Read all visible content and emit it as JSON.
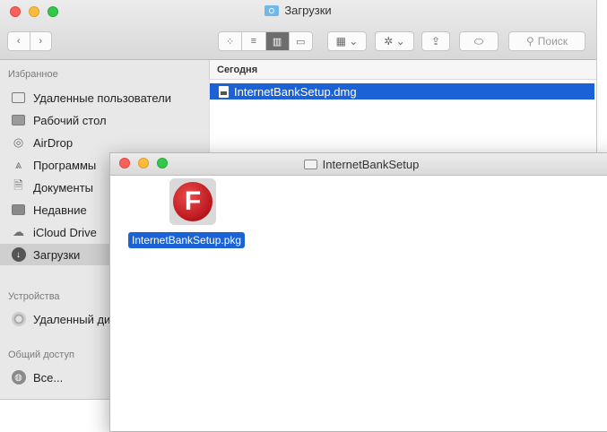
{
  "finder": {
    "title": "Загрузки",
    "search_placeholder": "Поиск",
    "sidebar": {
      "favorites_header": "Избранное",
      "favorites": [
        {
          "label": "Удаленные пользователи",
          "icon": "folder-icon"
        },
        {
          "label": "Рабочий стол",
          "icon": "desktop-icon"
        },
        {
          "label": "AirDrop",
          "icon": "airdrop-icon"
        },
        {
          "label": "Программы",
          "icon": "applications-icon"
        },
        {
          "label": "Документы",
          "icon": "documents-icon"
        },
        {
          "label": "Недавние",
          "icon": "recents-icon"
        },
        {
          "label": "iCloud Drive",
          "icon": "cloud-icon"
        },
        {
          "label": "Загрузки",
          "icon": "downloads-icon",
          "selected": true
        }
      ],
      "devices_header": "Устройства",
      "devices": [
        {
          "label": "Удаленный диск",
          "icon": "disc-icon"
        }
      ],
      "shared_header": "Общий доступ",
      "shared": [
        {
          "label": "Все...",
          "icon": "globe-icon"
        }
      ]
    },
    "column_header": "Сегодня",
    "files": [
      {
        "name": "InternetBankSetup.dmg",
        "selected": true
      }
    ]
  },
  "disk_window": {
    "title": "InternetBankSetup",
    "items": [
      {
        "name": "InternetBankSetup.pkg",
        "icon_letter": "F",
        "selected": true
      }
    ]
  },
  "colors": {
    "selection": "#1a62d5",
    "close": "#fc605c",
    "minimize": "#fdbc40",
    "zoom": "#34c84a",
    "pkg_icon": "#c41a21"
  }
}
